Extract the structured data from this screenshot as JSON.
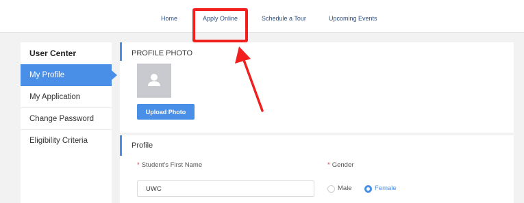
{
  "nav": {
    "items": [
      "Home",
      "Apply Online",
      "Schedule a Tour",
      "Upcoming Events"
    ]
  },
  "sidebar": {
    "title": "User Center",
    "items": [
      "My Profile",
      "My Application",
      "Change Password",
      "Eligibility Criteria"
    ],
    "active": "My Profile"
  },
  "photo_panel": {
    "title": "PROFILE PHOTO",
    "upload_label": "Upload Photo"
  },
  "profile_panel": {
    "title": "Profile",
    "first_name_label": "Student's First Name",
    "first_name_value": "UWC",
    "gender_label": "Gender",
    "gender_options": [
      "Male",
      "Female"
    ],
    "gender_selected": "Female",
    "required_mark": "*"
  },
  "colors": {
    "accent": "#4a8fe7",
    "annotation": "#f21f1f",
    "nav_text": "#2c4d80"
  }
}
